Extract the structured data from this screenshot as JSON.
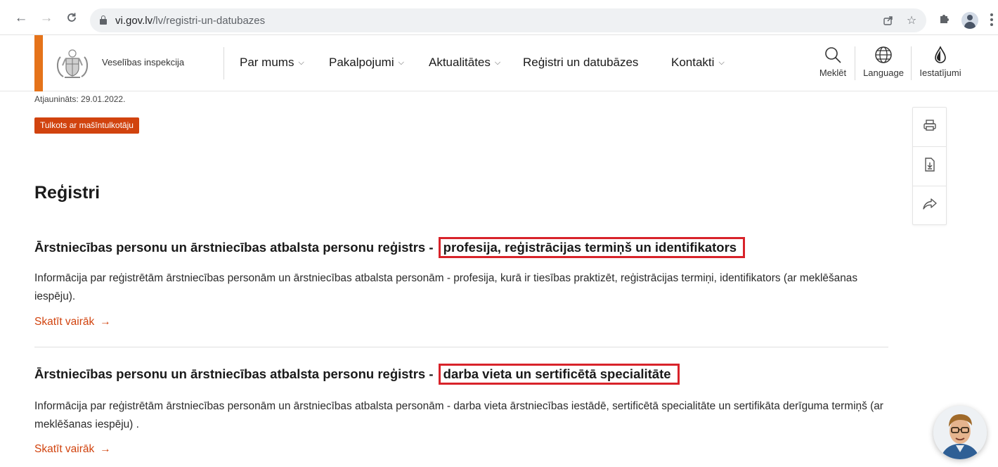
{
  "browser": {
    "url_domain": "vi.gov.lv",
    "url_path": "/lv/registri-un-datubazes"
  },
  "site": {
    "logo_text": "Veselības inspekcija",
    "accent_color": "#e5731a",
    "nav": [
      {
        "label": "Par mums",
        "has_dropdown": true
      },
      {
        "label": "Pakalpojumi",
        "has_dropdown": true
      },
      {
        "label": "Aktualitātes",
        "has_dropdown": true
      },
      {
        "label": "Reģistri un datubāzes",
        "has_dropdown": false
      },
      {
        "label": "Kontakti",
        "has_dropdown": true
      }
    ],
    "tools": {
      "search": "Meklēt",
      "language": "Language",
      "settings": "Iestatījumi"
    }
  },
  "page": {
    "updated": "Atjaunināts: 29.01.2022.",
    "machine_translation_badge": "Tulkots ar mašīntulkotāju",
    "badge_color": "#d1430e",
    "section_title": "Reģistri",
    "registers": [
      {
        "title_main": "Ārstniecības personu un ārstniecības atbalsta personu reģistrs -",
        "title_highlight": "profesija, reģistrācijas termiņš un identifikators",
        "description": "Informācija par reģistrētām ārstniecības personām un ārstniecības atbalsta personām - profesija, kurā ir tiesības praktizēt, reģistrācijas termiņi, identifikators (ar meklēšanas iespēju).",
        "link": "Skatīt vairāk"
      },
      {
        "title_main": "Ārstniecības personu un ārstniecības atbalsta personu reģistrs -",
        "title_highlight": "darba vieta un sertificētā specialitāte",
        "description": "Informācija par reģistrētām ārstniecības personām un ārstniecības atbalsta personām - darba vieta ārstniecības iestādē, sertificētā specialitāte un sertifikāta derīguma termiņš (ar meklēšanas iespēju) .",
        "link": "Skatīt vairāk"
      }
    ],
    "highlight_color": "#d8232a"
  }
}
